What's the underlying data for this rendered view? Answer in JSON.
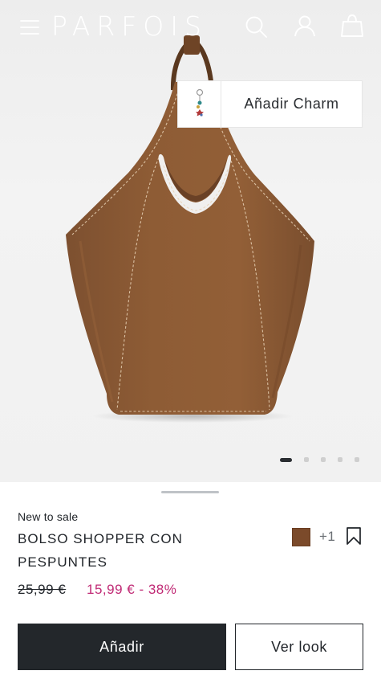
{
  "header": {
    "brand": "PARFOIS",
    "icons": [
      "menu-icon",
      "search-icon",
      "account-icon",
      "shopping-bag-icon"
    ]
  },
  "charm": {
    "label": "Añadir Charm",
    "thumbnail_icon": "charm-keychain-icon"
  },
  "gallery": {
    "total_images": 5,
    "active_index": 1
  },
  "product": {
    "badge": "New to sale",
    "name": "BOLSO SHOPPER CON PESPUNTES",
    "swatch_color": "#7b4a2a",
    "more_colors": "+1",
    "original_price": "25,99 €",
    "sale_price": "15,99 € - 38%",
    "save_icon": "bookmark-icon"
  },
  "actions": {
    "add_label": "Añadir",
    "look_label": "Ver look"
  },
  "colors": {
    "dark": "#23272b",
    "sale": "#c02a75",
    "bag": "#8a5a33"
  }
}
